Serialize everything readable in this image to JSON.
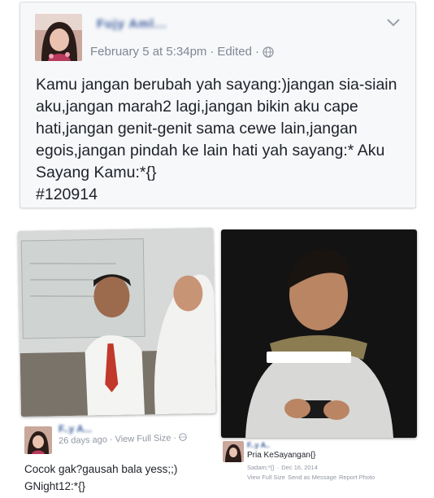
{
  "post": {
    "author": "Fujy Aml...",
    "timestamp": "February 5 at 5:34pm",
    "sep1": "·",
    "edited": "Edited",
    "sep2": "·",
    "text": "Kamu jangan berubah yah sayang:)jangan sia-siain\naku,jangan marah2 lagi,jangan bikin aku cape\nhati,jangan genit-genit sama cewe lain,jangan\negois,jangan pindah ke lain hati yah sayang:* Aku\nSayang Kamu:*{}\n#120914"
  },
  "comment_left": {
    "author": "F..y A...",
    "time": "26 days ago",
    "sep": "·",
    "view_full": "View Full Size",
    "sep2": "·",
    "text": "Cocok gak?gausah bala yess;;)\nGNight12:*{}"
  },
  "comment_right": {
    "author": "F..y A..",
    "text": "Pria KeSayangan{}",
    "meta_name": "Sadam;*{}",
    "sep": "·",
    "date": "Dec 16, 2014",
    "view_full": "View Full Size",
    "send": "Send as Message",
    "report": "Report Photo"
  },
  "icons": {
    "globe": "globe-icon",
    "chevron": "chevron-down-icon"
  },
  "colors": {
    "link": "#365899",
    "meta": "#7f8793",
    "card_bg": "#f7f8fa"
  }
}
